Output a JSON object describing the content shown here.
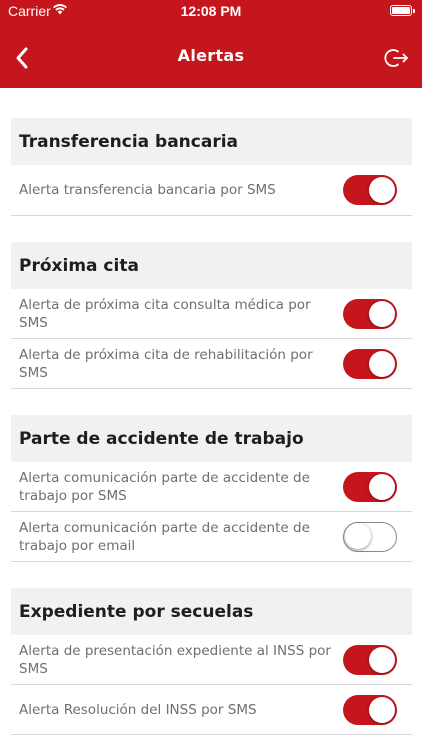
{
  "status_bar": {
    "carrier": "Carrier",
    "time": "12:08 PM"
  },
  "nav": {
    "title": "Alertas",
    "back_icon": "chevron-left-icon",
    "logout_icon": "logout-icon"
  },
  "colors": {
    "brand": "#c4161c",
    "section_bg": "#f1f1f1",
    "row_text": "#6f6f6f",
    "header_text": "#1e1e1e"
  },
  "sections": [
    {
      "title": "Transferencia bancaria",
      "items": [
        {
          "label": "Alerta transferencia bancaria por SMS",
          "enabled": true
        }
      ]
    },
    {
      "title": "Próxima cita",
      "items": [
        {
          "label": "Alerta de próxima cita consulta médica por SMS",
          "enabled": true
        },
        {
          "label": "Alerta de próxima cita de rehabilitación por SMS",
          "enabled": true
        }
      ]
    },
    {
      "title": "Parte de accidente de trabajo",
      "items": [
        {
          "label": "Alerta comunicación parte de accidente de trabajo por SMS",
          "enabled": true
        },
        {
          "label": "Alerta comunicación parte de accidente de trabajo por email",
          "enabled": false
        }
      ]
    },
    {
      "title": "Expediente por secuelas",
      "items": [
        {
          "label": "Alerta de presentación expediente al INSS por SMS",
          "enabled": true
        },
        {
          "label": "Alerta Resolución del INSS por SMS",
          "enabled": true
        }
      ]
    }
  ]
}
